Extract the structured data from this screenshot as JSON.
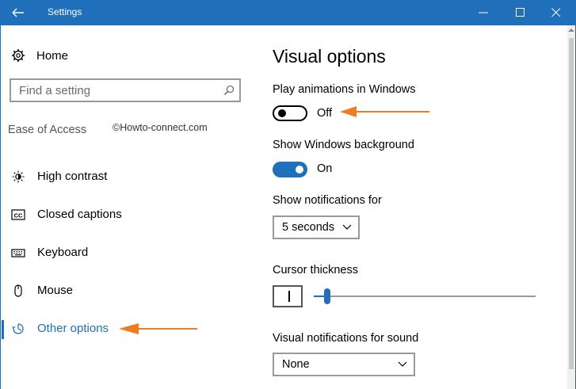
{
  "window": {
    "title": "Settings"
  },
  "sidebar": {
    "home_label": "Home",
    "search_placeholder": "Find a setting",
    "section_label": "Ease of Access",
    "watermark": "©Howto-connect.com",
    "items": [
      {
        "label": "High contrast",
        "icon": "sun-contrast-icon"
      },
      {
        "label": "Closed captions",
        "icon": "cc-icon"
      },
      {
        "label": "Keyboard",
        "icon": "keyboard-icon"
      },
      {
        "label": "Mouse",
        "icon": "mouse-icon"
      },
      {
        "label": "Other options",
        "icon": "other-options-icon",
        "selected": true
      }
    ]
  },
  "content": {
    "title": "Visual options",
    "animations": {
      "label": "Play animations in Windows",
      "state": "Off"
    },
    "background": {
      "label": "Show Windows background",
      "state": "On"
    },
    "notifications": {
      "label": "Show notifications for",
      "value": "5 seconds"
    },
    "cursor": {
      "label": "Cursor thickness",
      "slider_fraction": 0.06
    },
    "sound": {
      "label": "Visual notifications for sound",
      "value": "None"
    }
  },
  "colors": {
    "accent": "#1f6fba",
    "annotation": "#f07b22"
  }
}
